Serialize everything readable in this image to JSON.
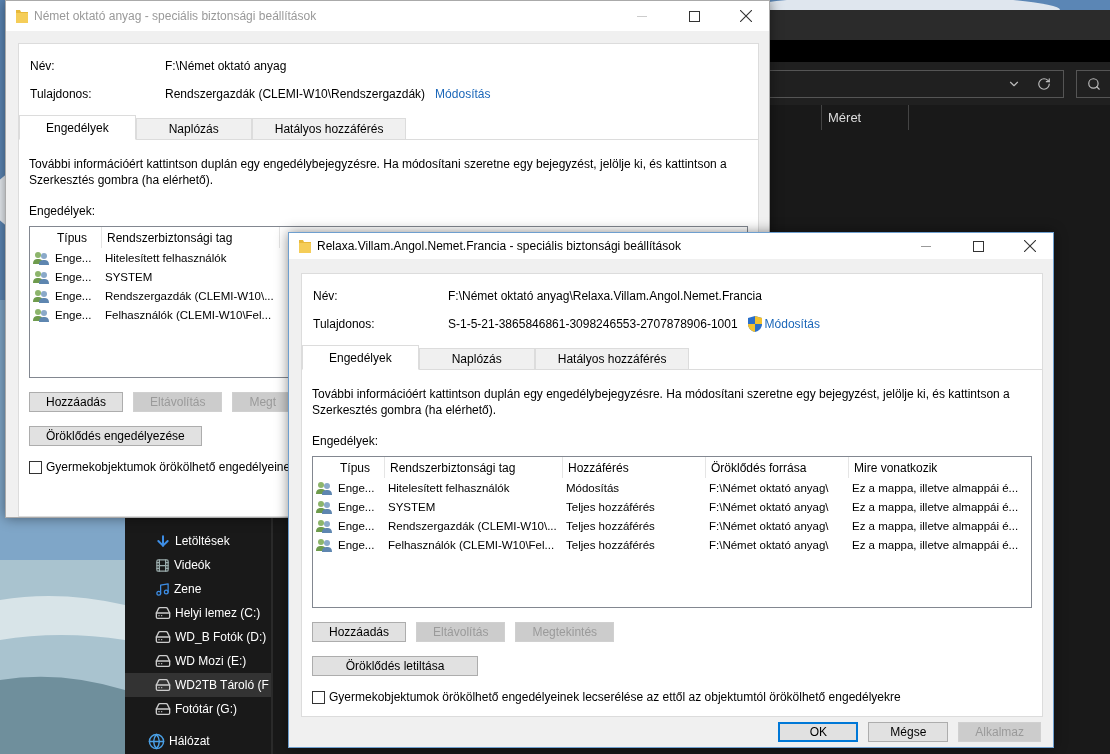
{
  "explorer": {
    "column_header": "Méret",
    "nav_items": [
      {
        "label": "Letöltések",
        "selected": false
      },
      {
        "label": "Videók",
        "selected": false
      },
      {
        "label": "Zene",
        "selected": false
      },
      {
        "label": "Helyi lemez (C:)",
        "selected": false
      },
      {
        "label": "WD_B Fotók (D:)",
        "selected": false
      },
      {
        "label": "WD Mozi (E:)",
        "selected": false
      },
      {
        "label": "WD2TB Tároló (F",
        "selected": true
      },
      {
        "label": "Fotótár (G:)",
        "selected": false
      }
    ],
    "nav_root_items": [
      {
        "label": "Hálózat",
        "selected": false
      }
    ]
  },
  "windows": [
    {
      "title": "Német oktató anyag - speciális biztonsági beállítások",
      "active": false,
      "name_label": "Név:",
      "name_value": "F:\\Német oktató anyag",
      "owner_label": "Tulajdonos:",
      "owner_value": "Rendszergazdák (CLEMI-W10\\Rendszergazdák)",
      "owner_link": "Módosítás",
      "owner_shield": false,
      "tabs": [
        {
          "label": "Engedélyek",
          "selected": true
        },
        {
          "label": "Naplózás",
          "selected": false
        },
        {
          "label": "Hatályos hozzáférés",
          "selected": false
        }
      ],
      "info": "További információért kattintson duplán egy engedélybejegyzésre. Ha módosítani szeretne egy bejegyzést, jelölje ki, és kattintson a Szerkesztés gombra (ha elérhető).",
      "list_label": "Engedélyek:",
      "columns": [
        "Típus",
        "Rendszerbiztonsági tag"
      ],
      "rows": [
        {
          "cells": [
            "Enge...",
            "Hitelesített felhasználók"
          ]
        },
        {
          "cells": [
            "Enge...",
            "SYSTEM"
          ]
        },
        {
          "cells": [
            "Enge...",
            "Rendszergazdák (CLEMI-W10\\..."
          ]
        },
        {
          "cells": [
            "Enge...",
            "Felhasználók (CLEMI-W10\\Fel..."
          ]
        }
      ],
      "buttons": [
        {
          "label": "Hozzáadás",
          "disabled": false
        },
        {
          "label": "Eltávolítás",
          "disabled": true
        },
        {
          "label": "Megt",
          "disabled": true
        }
      ],
      "inherit_button": "Öröklődés engedélyezése",
      "checkbox": {
        "label": "Gyermekobjektumok örökölhető engedélyeine",
        "checked": false
      }
    },
    {
      "title": "Relaxa.Villam.Angol.Nemet.Francia - speciális biztonsági beállítások",
      "active": true,
      "name_label": "Név:",
      "name_value": "F:\\Német oktató anyag\\Relaxa.Villam.Angol.Nemet.Francia",
      "owner_label": "Tulajdonos:",
      "owner_value": "S-1-5-21-3865846861-3098246553-2707878906-1001",
      "owner_link": "Módosítás",
      "owner_shield": true,
      "tabs": [
        {
          "label": "Engedélyek",
          "selected": true
        },
        {
          "label": "Naplózás",
          "selected": false
        },
        {
          "label": "Hatályos hozzáférés",
          "selected": false
        }
      ],
      "info": "További információért kattintson duplán egy engedélybejegyzésre. Ha módosítani szeretne egy bejegyzést, jelölje ki, és kattintson a Szerkesztés gombra (ha elérhető).",
      "list_label": "Engedélyek:",
      "columns": [
        "Típus",
        "Rendszerbiztonsági tag",
        "Hozzáférés",
        "Öröklődés forrása",
        "Mire vonatkozik"
      ],
      "rows": [
        {
          "cells": [
            "Enge...",
            "Hitelesített felhasználók",
            "Módosítás",
            "F:\\Német oktató anyag\\",
            "Ez a mappa, illetve almappái é..."
          ]
        },
        {
          "cells": [
            "Enge...",
            "SYSTEM",
            "Teljes hozzáférés",
            "F:\\Német oktató anyag\\",
            "Ez a mappa, illetve almappái é..."
          ]
        },
        {
          "cells": [
            "Enge...",
            "Rendszergazdák (CLEMI-W10\\...",
            "Teljes hozzáférés",
            "F:\\Német oktató anyag\\",
            "Ez a mappa, illetve almappái é..."
          ]
        },
        {
          "cells": [
            "Enge...",
            "Felhasználók (CLEMI-W10\\Fel...",
            "Teljes hozzáférés",
            "F:\\Német oktató anyag\\",
            "Ez a mappa, illetve almappái é..."
          ]
        }
      ],
      "buttons": [
        {
          "label": "Hozzáadás",
          "disabled": false
        },
        {
          "label": "Eltávolítás",
          "disabled": true
        },
        {
          "label": "Megtekintés",
          "disabled": true
        }
      ],
      "inherit_button": "Öröklődés letiltása",
      "checkbox": {
        "label": "Gyermekobjektumok örökölhető engedélyeinek lecserélése az ettől az objektumtól örökölhető engedélyekre",
        "checked": false
      },
      "dialog_buttons": [
        {
          "label": "OK",
          "default": true,
          "disabled": false
        },
        {
          "label": "Mégse",
          "default": false,
          "disabled": false
        },
        {
          "label": "Alkalmaz",
          "default": false,
          "disabled": true
        }
      ]
    }
  ]
}
